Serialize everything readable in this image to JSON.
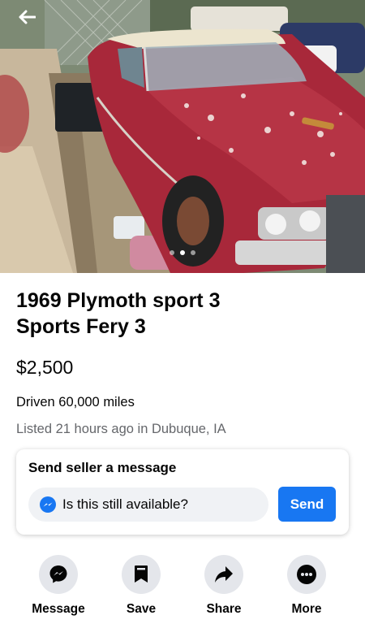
{
  "photo": {
    "alt": "",
    "slide_count": 3,
    "active_slide": 2
  },
  "listing": {
    "title_line1": "1969 Plymoth sport 3",
    "title_line2": "Sports Fery 3",
    "price": "$2,500",
    "mileage": "Driven 60,000 miles",
    "listed": "Listed 21 hours ago in Dubuque, IA"
  },
  "message_card": {
    "heading": "Send seller a message",
    "input_value": "Is this still available?",
    "send_label": "Send"
  },
  "actions": [
    {
      "label": "Message",
      "icon": "messenger-icon"
    },
    {
      "label": "Save",
      "icon": "bookmark-icon"
    },
    {
      "label": "Share",
      "icon": "share-arrow-icon"
    },
    {
      "label": "More",
      "icon": "more-dots-icon"
    }
  ],
  "colors": {
    "accent": "#1877f2",
    "secondary_text": "#65676b",
    "action_circle": "#e4e6eb",
    "car_red": "#a8283a"
  }
}
